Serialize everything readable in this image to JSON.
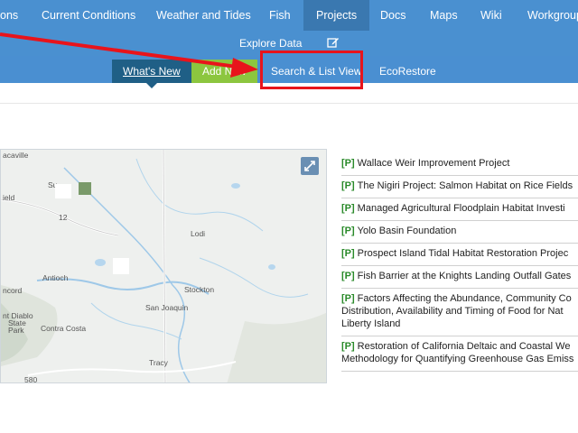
{
  "topnav": {
    "items": [
      {
        "label": "ons"
      },
      {
        "label": "Current Conditions"
      },
      {
        "label": "Weather and Tides"
      },
      {
        "label": "Fish"
      },
      {
        "label": "Projects"
      },
      {
        "label": "Docs"
      },
      {
        "label": "Maps"
      },
      {
        "label": "Wiki"
      },
      {
        "label": "Workgroup"
      }
    ],
    "active": "Projects"
  },
  "explore": {
    "label": "Explore Data",
    "icon": "edit-icon"
  },
  "subnav": {
    "whats_new": "What's New",
    "add_new": "Add New",
    "search_list": "Search & List View",
    "ecorestore": "EcoRestore"
  },
  "map": {
    "places": [
      "acaville",
      "Su",
      "ield",
      "12",
      "Lodi",
      "Antioch",
      "ncord",
      "nt Diablo",
      "State",
      "Park",
      "Stockton",
      "San Joaquin",
      "Contra Costa",
      "Tracy",
      "580"
    ],
    "expand_icon": "expand-icon"
  },
  "projects": {
    "badge": "[P]",
    "items": [
      {
        "lines": [
          "Wallace Weir Improvement Project"
        ]
      },
      {
        "lines": [
          "The Nigiri Project: Salmon Habitat on Rice Fields"
        ]
      },
      {
        "lines": [
          "Managed Agricultural Floodplain Habitat Investi"
        ]
      },
      {
        "lines": [
          "Yolo Basin Foundation"
        ]
      },
      {
        "lines": [
          "Prospect Island Tidal Habitat Restoration Projec"
        ]
      },
      {
        "lines": [
          "Fish Barrier at the Knights Landing Outfall Gates"
        ]
      },
      {
        "lines": [
          "Factors Affecting the Abundance, Community Co",
          "Distribution, Availability and Timing of Food for Nat",
          "Liberty Island"
        ]
      },
      {
        "lines": [
          "Restoration of California Deltaic and Coastal We",
          "Methodology for Quantifying Greenhouse Gas Emiss"
        ]
      }
    ]
  },
  "colors": {
    "nav": "#4a90d0",
    "active": "#3a78b0",
    "add_new": "#8cc63f",
    "whats_new": "#1f5f86",
    "annotation": "#e8141b",
    "badge": "#2a8a2a"
  }
}
